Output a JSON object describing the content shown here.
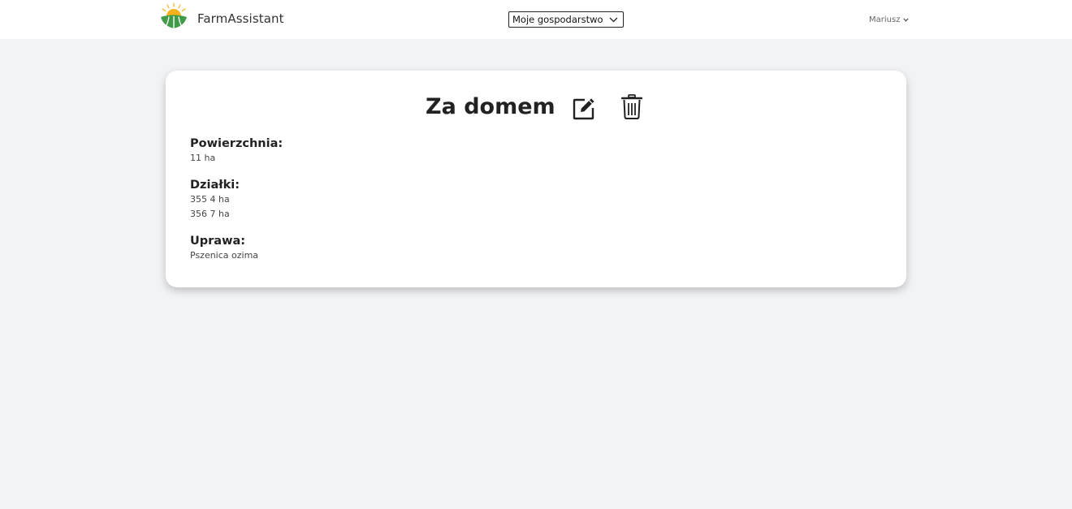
{
  "navbar": {
    "brand_name": "FarmAssistant",
    "farm_select": {
      "value": "Moje gospodarstwo"
    },
    "user_menu": {
      "name": "Mariusz"
    }
  },
  "field": {
    "name": "Za domem",
    "area_label": "Powierzchnia:",
    "area_value": "11 ha",
    "plots_label": "Działki:",
    "plots": [
      "355 4 ha",
      "356 7 ha"
    ],
    "crop_label": "Uprawa:",
    "crop_value": "Pszenica ozima"
  },
  "icons": {
    "logo": "sun-over-field-logo",
    "edit": "pencil-square-icon",
    "delete": "trash-icon",
    "dropdown": "chevron-down-icon"
  },
  "colors": {
    "background": "#f2f3f5",
    "navbar": "#ffffff",
    "card": "#ffffff",
    "logo_green": "#3f9b48",
    "logo_sun": "#f5b21a"
  }
}
